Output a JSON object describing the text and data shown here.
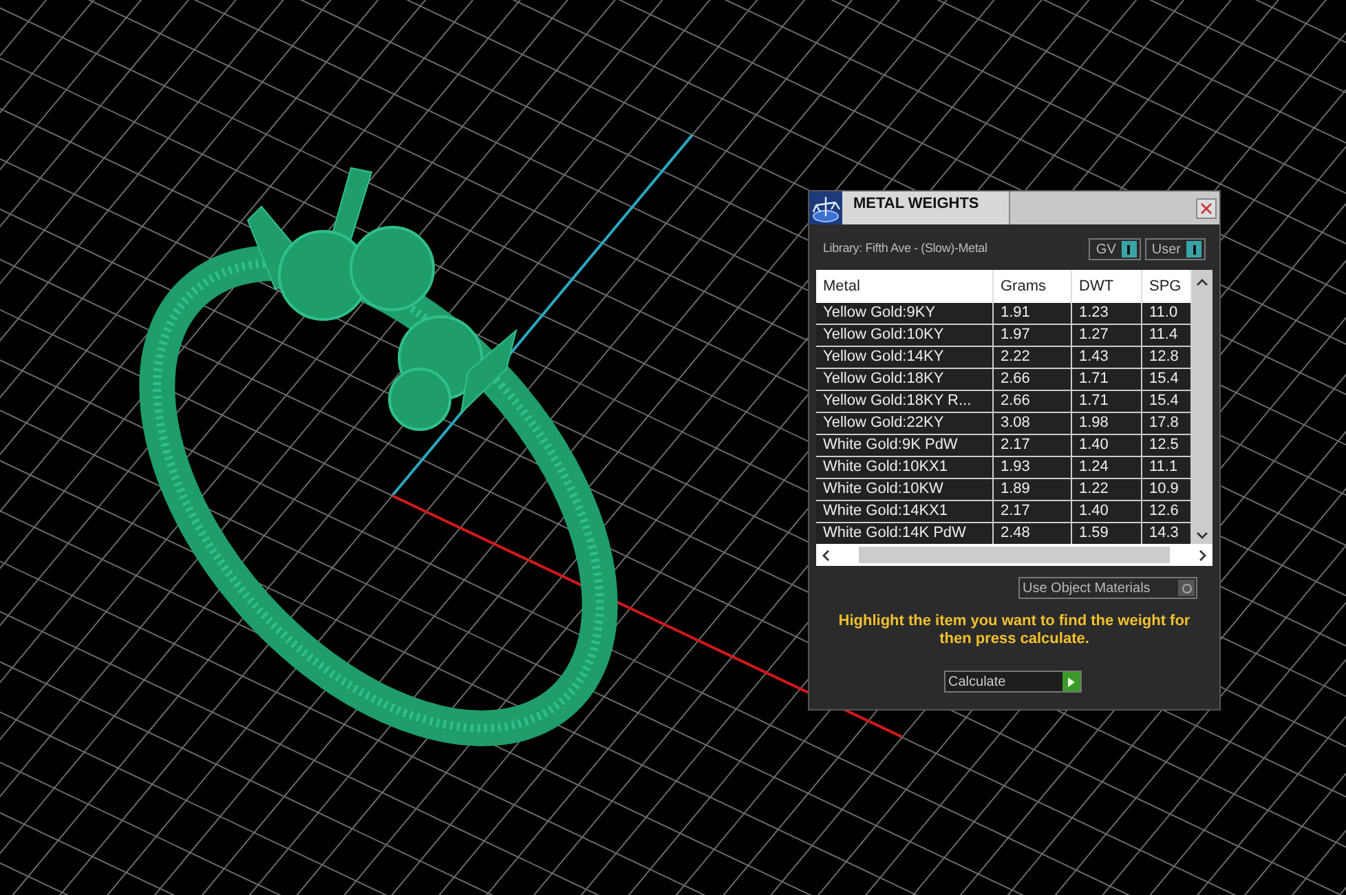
{
  "panel": {
    "title": "METAL WEIGHTS",
    "library": "Library: Fifth Ave - (Slow)-Metal",
    "toggles": [
      {
        "label": "GV",
        "on": true
      },
      {
        "label": "User",
        "on": true
      }
    ],
    "table": {
      "columns": [
        "Metal",
        "Grams",
        "DWT",
        "SPG"
      ],
      "rows": [
        {
          "cells": [
            "Yellow Gold:9KY",
            "1.91",
            "1.23",
            "11.0"
          ],
          "selected": false
        },
        {
          "cells": [
            "Yellow Gold:10KY",
            "1.97",
            "1.27",
            "11.4"
          ],
          "selected": false
        },
        {
          "cells": [
            "Yellow Gold:14KY",
            "2.22",
            "1.43",
            "12.8"
          ],
          "selected": false
        },
        {
          "cells": [
            "Yellow Gold:18KY",
            "2.66",
            "1.71",
            "15.4"
          ],
          "selected": false
        },
        {
          "cells": [
            "Yellow Gold:18KY R...",
            "2.66",
            "1.71",
            "15.4"
          ],
          "selected": false
        },
        {
          "cells": [
            "Yellow Gold:22KY",
            "3.08",
            "1.98",
            "17.8"
          ],
          "selected": false
        },
        {
          "cells": [
            "White Gold:9K PdW",
            "2.17",
            "1.40",
            "12.5"
          ],
          "selected": false
        },
        {
          "cells": [
            "White Gold:10KX1",
            "1.93",
            "1.24",
            "11.1"
          ],
          "selected": false
        },
        {
          "cells": [
            "White Gold:10KW",
            "1.89",
            "1.22",
            "10.9"
          ],
          "selected": false
        },
        {
          "cells": [
            "White Gold:14KX1",
            "2.17",
            "1.40",
            "12.6"
          ],
          "selected": false
        },
        {
          "cells": [
            "White Gold:14K PdW",
            "2.48",
            "1.59",
            "14.3"
          ],
          "selected": false
        }
      ]
    },
    "use_object_materials": {
      "label": "Use Object Materials",
      "on": false
    },
    "hint": "Highlight the item you want to find the weight for then press calculate.",
    "calculate": "Calculate"
  }
}
